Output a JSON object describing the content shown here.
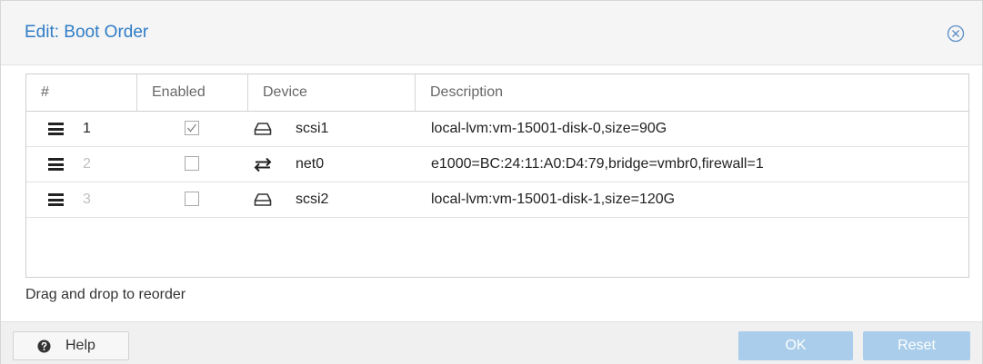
{
  "dialog": {
    "title": "Edit: Boot Order",
    "hint": "Drag and drop to reorder",
    "accent_color": "#2f7dc7"
  },
  "grid": {
    "columns": [
      "#",
      "Enabled",
      "Device",
      "Description"
    ],
    "rows": [
      {
        "order": "1",
        "enabled": true,
        "device_icon": "disk-icon",
        "device": "scsi1",
        "description": "local-lvm:vm-15001-disk-0,size=90G"
      },
      {
        "order": "2",
        "enabled": false,
        "device_icon": "network-icon",
        "device": "net0",
        "description": "e1000=BC:24:11:A0:D4:79,bridge=vmbr0,firewall=1"
      },
      {
        "order": "3",
        "enabled": false,
        "device_icon": "disk-icon",
        "device": "scsi2",
        "description": "local-lvm:vm-15001-disk-1,size=120G"
      }
    ]
  },
  "footer": {
    "help_label": "Help",
    "ok_label": "OK",
    "reset_label": "Reset",
    "button_color": "#a9cdea"
  }
}
